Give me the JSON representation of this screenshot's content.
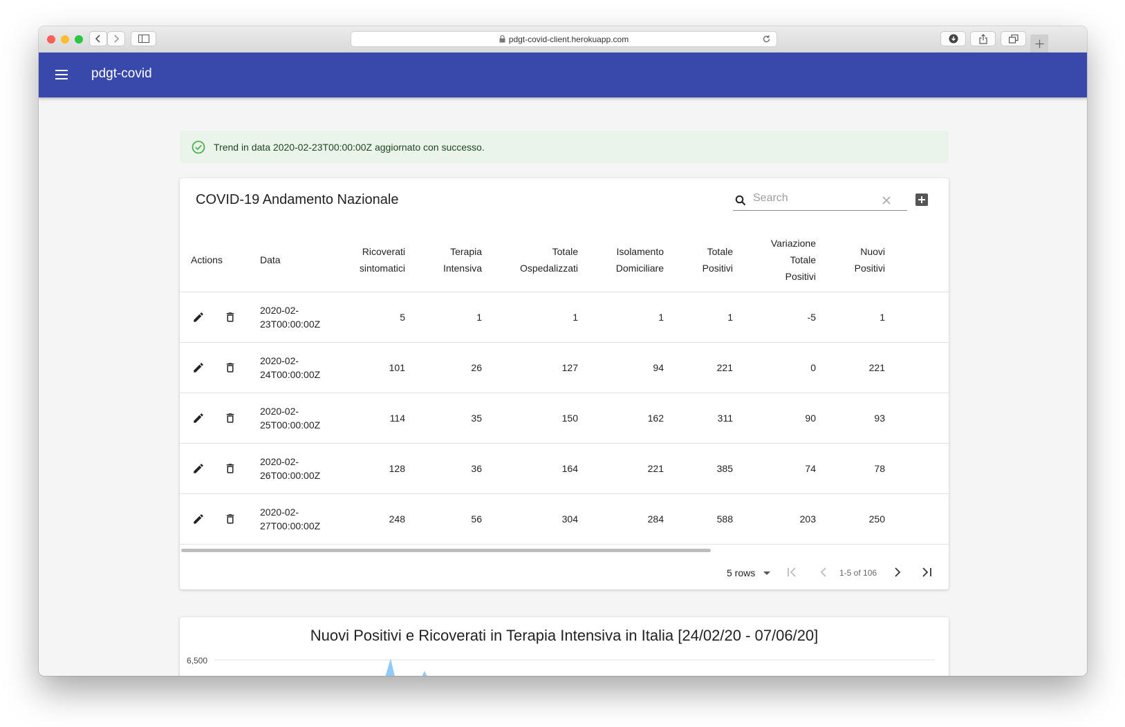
{
  "browser": {
    "url": "pdgt-covid-client.herokuapp.com"
  },
  "app": {
    "title": "pdgt-covid"
  },
  "alert": {
    "message": "Trend in data 2020-02-23T00:00:00Z aggiornato con successo."
  },
  "table_card": {
    "title": "COVID-19 Andamento Nazionale",
    "search_placeholder": "Search",
    "columns": {
      "actions": "Actions",
      "data": "Data",
      "ricoverati": [
        "Ricoverati",
        "sintomatici"
      ],
      "terapia": [
        "Terapia",
        "Intensiva"
      ],
      "ospedalizzati": [
        "Totale",
        "Ospedalizzati"
      ],
      "isolamento": [
        "Isolamento",
        "Domiciliare"
      ],
      "positivi": [
        "Totale",
        "Positivi"
      ],
      "variazione": [
        "Variazione",
        "Totale",
        "Positivi"
      ],
      "nuovi": [
        "Nuovi",
        "Positivi"
      ]
    },
    "rows": [
      {
        "date_line1": "2020-02-",
        "date_line2": "23T00:00:00Z",
        "ricoverati": "5",
        "terapia": "1",
        "ospedalizzati": "1",
        "isolamento": "1",
        "positivi": "1",
        "variazione": "-5",
        "nuovi": "1"
      },
      {
        "date_line1": "2020-02-",
        "date_line2": "24T00:00:00Z",
        "ricoverati": "101",
        "terapia": "26",
        "ospedalizzati": "127",
        "isolamento": "94",
        "positivi": "221",
        "variazione": "0",
        "nuovi": "221"
      },
      {
        "date_line1": "2020-02-",
        "date_line2": "25T00:00:00Z",
        "ricoverati": "114",
        "terapia": "35",
        "ospedalizzati": "150",
        "isolamento": "162",
        "positivi": "311",
        "variazione": "90",
        "nuovi": "93"
      },
      {
        "date_line1": "2020-02-",
        "date_line2": "26T00:00:00Z",
        "ricoverati": "128",
        "terapia": "36",
        "ospedalizzati": "164",
        "isolamento": "221",
        "positivi": "385",
        "variazione": "74",
        "nuovi": "78"
      },
      {
        "date_line1": "2020-02-",
        "date_line2": "27T00:00:00Z",
        "ricoverati": "248",
        "terapia": "56",
        "ospedalizzati": "304",
        "isolamento": "284",
        "positivi": "588",
        "variazione": "203",
        "nuovi": "250"
      }
    ],
    "pagination": {
      "rows_label": "5 rows",
      "range_label": "1-5 of 106"
    }
  },
  "chart": {
    "title": "Nuovi Positivi e Ricoverati in Terapia Intensiva in Italia [24/02/20 - 07/06/20]",
    "y_tick_top": "6,500",
    "series_color": "#90caf9"
  },
  "colors": {
    "appbar": "#3949ab",
    "alert_bg": "#eaf4ea",
    "success_icon": "#4caf50"
  }
}
